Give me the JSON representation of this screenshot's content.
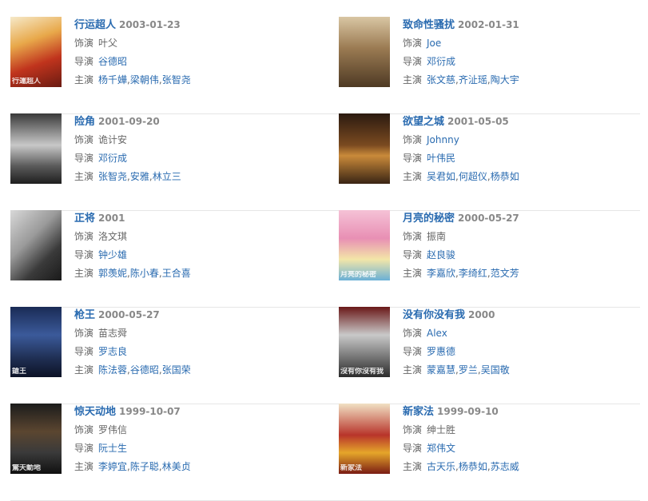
{
  "labels": {
    "role": "饰演",
    "director": "导演",
    "cast": "主演",
    "separator": ","
  },
  "films": [
    {
      "title": "行运超人",
      "date": "2003-01-23",
      "role": "叶父",
      "director": "谷德昭",
      "cast": [
        "杨千嬅",
        "梁朝伟",
        "张智尧"
      ],
      "poster_caption": "行運超人"
    },
    {
      "title": "致命性骚扰",
      "date": "2002-01-31",
      "role": "Joe",
      "director": "邓衍成",
      "cast": [
        "张文慈",
        "齐沚瑶",
        "陶大宇"
      ],
      "poster_caption": ""
    },
    {
      "title": "险角",
      "date": "2001-09-20",
      "role": "诡计安",
      "director": "邓衍成",
      "cast": [
        "张智尧",
        "安雅",
        "林立三"
      ],
      "poster_caption": ""
    },
    {
      "title": "欲望之城",
      "date": "2001-05-05",
      "role": "Johnny",
      "director": "叶伟民",
      "cast": [
        "吴君如",
        "何超仪",
        "杨恭如"
      ],
      "poster_caption": ""
    },
    {
      "title": "正将",
      "date": "2001",
      "role": "洛文琪",
      "director": "钟少雄",
      "cast": [
        "郭羡妮",
        "陈小春",
        "王合喜"
      ],
      "poster_caption": ""
    },
    {
      "title": "月亮的秘密",
      "date": "2000-05-27",
      "role": "振南",
      "director": "赵良骏",
      "cast": [
        "李嘉欣",
        "李绮红",
        "范文芳"
      ],
      "poster_caption": "月亮的秘密"
    },
    {
      "title": "枪王",
      "date": "2000-05-27",
      "role": "苗志舜",
      "director": "罗志良",
      "cast": [
        "陈法蓉",
        "谷德昭",
        "张国荣"
      ],
      "poster_caption": "鎗王"
    },
    {
      "title": "没有你没有我",
      "date": "2000",
      "role": "Alex",
      "director": "罗惠德",
      "cast": [
        "蒙嘉慧",
        "罗兰",
        "吴国敬"
      ],
      "poster_caption": "沒有你沒有我"
    },
    {
      "title": "惊天动地",
      "date": "1999-10-07",
      "role": "罗伟信",
      "director": "阮士生",
      "cast": [
        "李婷宜",
        "陈子聪",
        "林美贞"
      ],
      "poster_caption": "驚天動地"
    },
    {
      "title": "新家法",
      "date": "1999-09-10",
      "role": "绅士胜",
      "director": "郑伟文",
      "cast": [
        "古天乐",
        "杨恭如",
        "苏志威"
      ],
      "poster_caption": "新家法"
    }
  ]
}
